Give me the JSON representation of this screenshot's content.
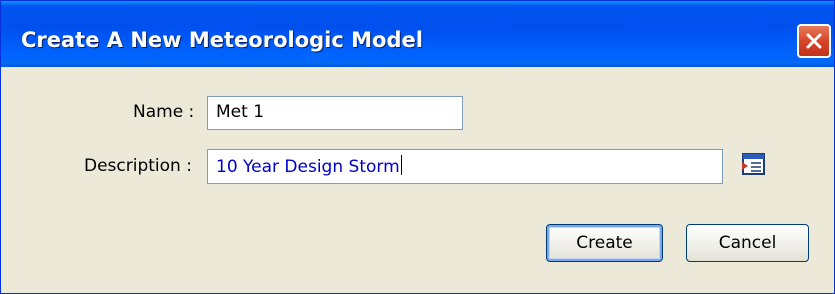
{
  "dialog": {
    "title": "Create A New Meteorologic Model",
    "close_icon": "close-icon"
  },
  "form": {
    "name_label": "Name :",
    "name_value": "Met 1",
    "description_label": "Description :",
    "description_value": "10 Year Design Storm",
    "description_editor_icon": "text-editor-icon"
  },
  "buttons": {
    "create_label": "Create",
    "cancel_label": "Cancel"
  },
  "colors": {
    "titlebar": "#0053ee",
    "dialog_background": "#ece9d8",
    "close_button": "#d8452a",
    "description_text": "#0000cc"
  }
}
